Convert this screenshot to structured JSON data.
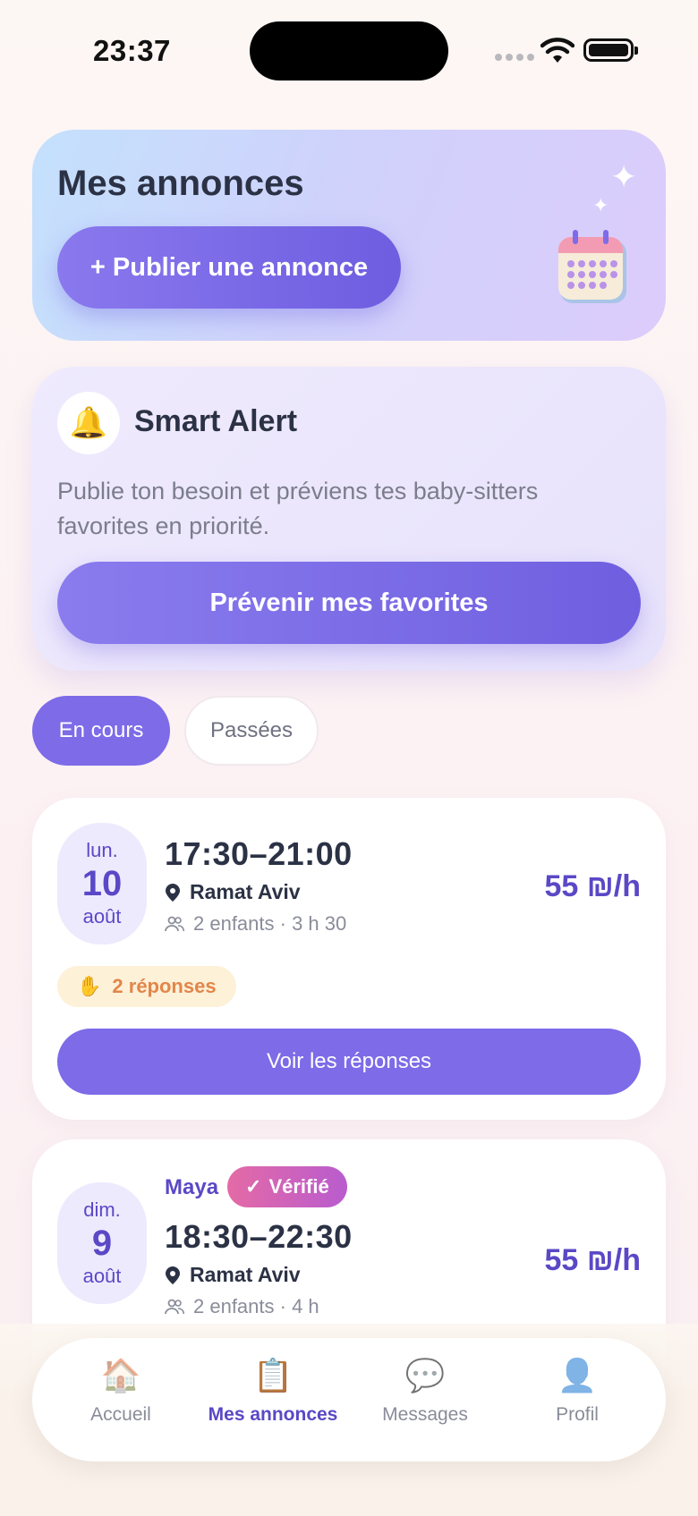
{
  "status_bar": {
    "time": "23:37"
  },
  "hero": {
    "title": "Mes annonces",
    "publish_label": "+ Publier une annonce",
    "sparkle": "✦",
    "calendar_icon": "calendar-icon"
  },
  "smart_alert": {
    "bell": "🔔",
    "title": "Smart Alert",
    "description": "Publie ton besoin et préviens tes baby-sitters favorites en priorité.",
    "button_label": "Prévenir mes favorites"
  },
  "tabs": [
    {
      "label": "En cours",
      "active": true
    },
    {
      "label": "Passées",
      "active": false
    }
  ],
  "bookings": [
    {
      "dow": "lun.",
      "day": "10",
      "month": "août",
      "slot": "17:30–21:00",
      "location": "Ramat Aviv",
      "meta": "2 enfants · 3 h 30",
      "price": "55 ₪/h",
      "responses_emoji": "✋",
      "responses": "2 réponses",
      "button_label": "Voir les réponses"
    },
    {
      "sitter": "Maya",
      "verified_check": "✓",
      "verified": "Vérifié",
      "dow": "dim.",
      "day": "9",
      "month": "août",
      "slot": "18:30–22:30",
      "location": "Ramat Aviv",
      "meta": "2 enfants · 4 h",
      "price": "55 ₪/h"
    }
  ],
  "nav": [
    {
      "icon": "🏠",
      "label": "Accueil",
      "active": false
    },
    {
      "icon": "📋",
      "label": "Mes annonces",
      "active": true
    },
    {
      "icon": "💬",
      "label": "Messages",
      "active": false
    },
    {
      "icon": "👤",
      "label": "Profil",
      "active": false
    }
  ],
  "colors": {
    "accent": "#7d6be8",
    "accent_dark": "#5a48c6",
    "badge_orange": "#e2864a",
    "verified_pink": "#e46aa5"
  }
}
